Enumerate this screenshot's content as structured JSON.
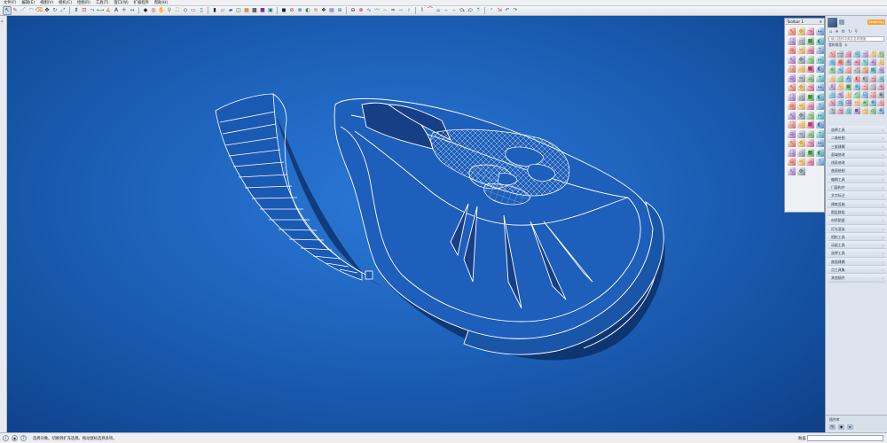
{
  "menu": [
    "文件(F)",
    "编辑(E)",
    "视图(V)",
    "相机(C)",
    "绘图(R)",
    "工具(T)",
    "窗口(W)",
    "扩展程序",
    "帮助(H)"
  ],
  "toolbar_icons": [
    "select-icon",
    "pencil-icon",
    "line-icon",
    "arc-icon",
    "eraser-icon",
    "move-icon",
    "rotate-icon",
    "scale-icon",
    "pushpull-icon",
    "offset-icon",
    "followme-icon",
    "tape-icon",
    "protractor-icon",
    "text-icon",
    "axes-icon",
    "dimension-icon",
    "paint-icon",
    "orbit-icon",
    "pan-icon",
    "zoom-icon",
    "zoom-extents-icon",
    "iso-view-icon",
    "top-view-icon",
    "front-view-icon",
    "right-view-icon",
    "back-view-icon",
    "left-view-icon",
    "xray-icon",
    "wireframe-icon",
    "hidden-line-icon",
    "shaded-icon",
    "textured-icon",
    "monochrome-icon",
    "section-plane-icon",
    "section-cut-icon",
    "shadow-icon",
    "fog-icon",
    "component-icon",
    "group-icon",
    "solid-union-icon",
    "solid-subtract-icon",
    "solid-trim-icon",
    "curve-tool-icon",
    "bezier-icon",
    "spline-icon",
    "loft-icon",
    "sweep-icon",
    "skin-icon",
    "subdivide-icon",
    "smooth-icon",
    "weld-icon",
    "joint-push-icon",
    "shape-bender-icon",
    "flowify-icon",
    "vertex-tools-icon",
    "extrude-icon",
    "round-corner-icon",
    "fredo-scale-icon",
    "undo-icon",
    "redo-icon"
  ],
  "palette": {
    "title": "Toolbar 1",
    "icons": [
      "line-icon",
      "arc-icon",
      "rect-icon",
      "circle-icon",
      "polygon-icon",
      "freehand-icon",
      "eraser-icon",
      "paint-icon",
      "move-icon",
      "rotate-icon",
      "scale-icon",
      "pushpull-icon",
      "offset-icon",
      "followme-icon",
      "tape-icon",
      "dimension-icon",
      "text-icon",
      "axes-icon",
      "section-icon",
      "orbit-icon",
      "pan-icon",
      "zoom-icon",
      "window-zoom-icon",
      "extents-icon",
      "prev-view-icon",
      "walk-icon",
      "look-icon",
      "position-camera-icon",
      "component-icon",
      "group-icon",
      "outliner-icon",
      "layer-icon",
      "material-icon",
      "style-icon",
      "scene-icon",
      "shadow-icon",
      "fog-icon",
      "solid-icon",
      "union-icon",
      "subtract-icon",
      "intersect-icon",
      "trim-icon",
      "split-icon",
      "outer-shell-icon",
      "sandbox-icon",
      "drape-icon",
      "stamp-icon",
      "smoove-icon",
      "add-detail-icon",
      "flip-edge-icon",
      "contour-icon",
      "terrain-icon",
      "photo-match-icon",
      "3dwarehouse-icon",
      "extension-icon",
      "ruby-icon",
      "import-icon",
      "export-icon",
      "print-icon",
      "settings-icon",
      "help-icon",
      "info-icon"
    ]
  },
  "rpanel": {
    "button": "SketchUp",
    "search_placeholder": "输入插件中英文名称搜索",
    "sub_tabs": [
      "我的常用",
      "↻"
    ],
    "categories": [
      "选择工具",
      "二维绘图",
      "三维建模",
      "面域修改",
      "线条修改",
      "曲面绘制",
      "编辑工具",
      "门窗构件",
      "文字标注",
      "建筑设施",
      "图层群组",
      "材质贴图",
      "灯光渲染",
      "相机工具",
      "动画工具",
      "选择工具",
      "曲面建模",
      "点工具集",
      "其他插件"
    ],
    "bottom_title": "插件库"
  },
  "status": {
    "message": "选择对象。切换到扩充选择。拖动鼠标选择多项。",
    "measure_label": "数值"
  },
  "colors": {
    "viewport_center": "#2a78d6",
    "viewport_edge": "#0f3f87",
    "wire": "#ffffff",
    "shadow": "#0d2f66"
  }
}
